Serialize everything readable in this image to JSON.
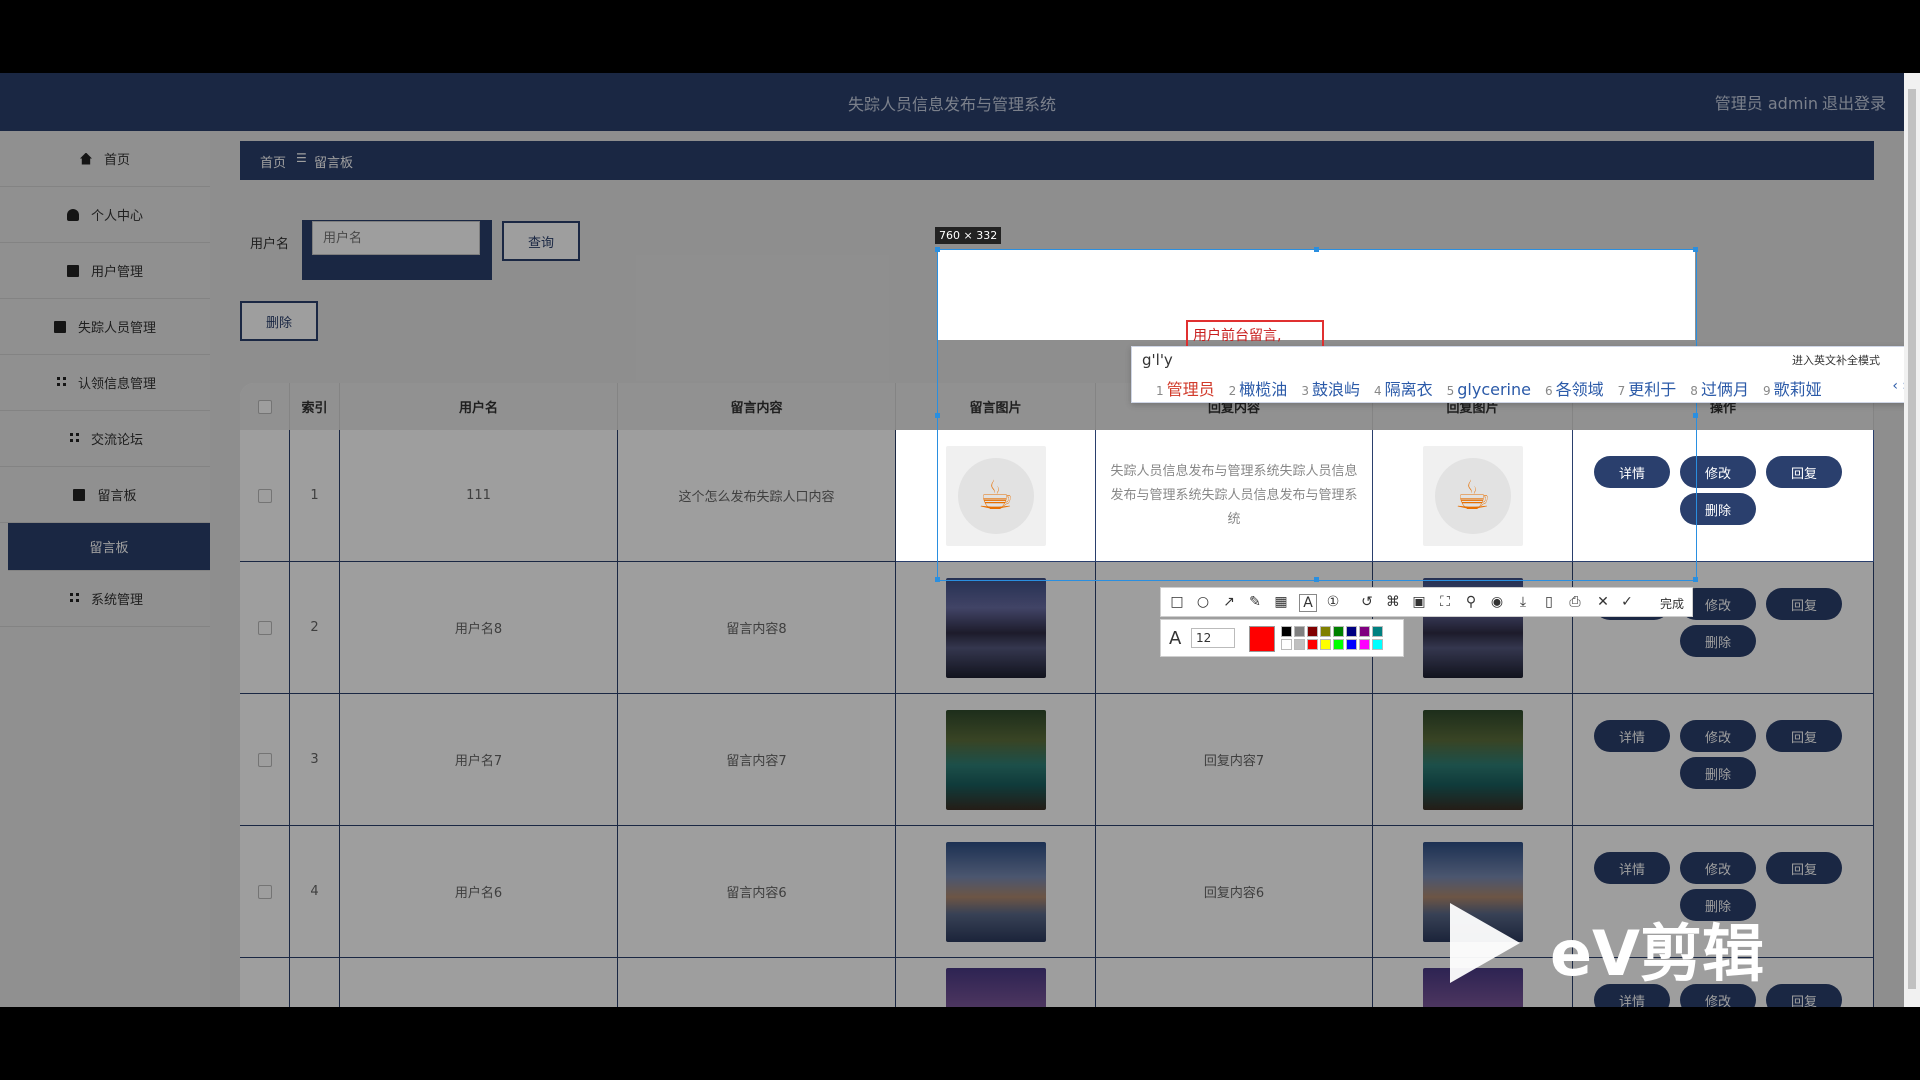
{
  "header": {
    "title": "失踪人员信息发布与管理系统",
    "admin": "管理员 admin",
    "logout": "退出登录"
  },
  "sidebar": {
    "items": [
      {
        "label": "首页",
        "icon": "home-icon"
      },
      {
        "label": "个人中心",
        "icon": "user-icon"
      },
      {
        "label": "用户管理",
        "icon": "clipboard-icon"
      },
      {
        "label": "失踪人员管理",
        "icon": "chat-icon"
      },
      {
        "label": "认领信息管理",
        "icon": "grid-icon"
      },
      {
        "label": "交流论坛",
        "icon": "grid-icon"
      },
      {
        "label": "留言板",
        "icon": "monitor-icon"
      },
      {
        "label": "留言板",
        "icon": "",
        "active": true
      },
      {
        "label": "系统管理",
        "icon": "grid-icon"
      }
    ]
  },
  "breadcrumb": {
    "home": "首页",
    "separator": "☰",
    "current": "留言板"
  },
  "search": {
    "label": "用户名",
    "placeholder": "用户名",
    "query_button": "查询",
    "delete_button": "删除"
  },
  "table": {
    "headers": [
      "",
      "索引",
      "用户名",
      "留言内容",
      "留言图片",
      "回复内容",
      "回复图片",
      "操作"
    ],
    "rows": [
      {
        "index": "1",
        "user": "111",
        "content": "这个怎么发布失踪人口内容",
        "reply": "失踪人员信息发布与管理系统失踪人员信息发布与管理系统失踪人员信息发布与管理系统"
      },
      {
        "index": "2",
        "user": "用户名8",
        "content": "留言内容8",
        "reply": ""
      },
      {
        "index": "3",
        "user": "用户名7",
        "content": "留言内容7",
        "reply": "回复内容7"
      },
      {
        "index": "4",
        "user": "用户名6",
        "content": "留言内容6",
        "reply": "回复内容6"
      },
      {
        "index": "",
        "user": "",
        "content": "",
        "reply": ""
      }
    ],
    "actions": {
      "detail": "详情",
      "edit": "修改",
      "reply": "回复",
      "delete": "删除"
    }
  },
  "capture": {
    "size_label": "760 × 332",
    "annotation_text": "用户前台留言,",
    "font_size": "12",
    "done": "完成",
    "current_color": "#ff0000",
    "palette": [
      "#000000",
      "#808080",
      "#800000",
      "#808000",
      "#008000",
      "#000080",
      "#800080",
      "#008080",
      "#ffffff",
      "#c0c0c0",
      "#ff0000",
      "#ffff00",
      "#00ff00",
      "#0000ff",
      "#ff00ff",
      "#00ffff"
    ]
  },
  "ime": {
    "typed": "g'l'y",
    "mode": "进入英文补全模式",
    "candidates": [
      "管理员",
      "橄榄油",
      "鼓浪屿",
      "隔离衣",
      "glycerine",
      "各领域",
      "更利于",
      "过俩月",
      "歌莉娅"
    ],
    "nav": "‹ ›"
  },
  "watermark": {
    "text": "eV剪辑"
  }
}
